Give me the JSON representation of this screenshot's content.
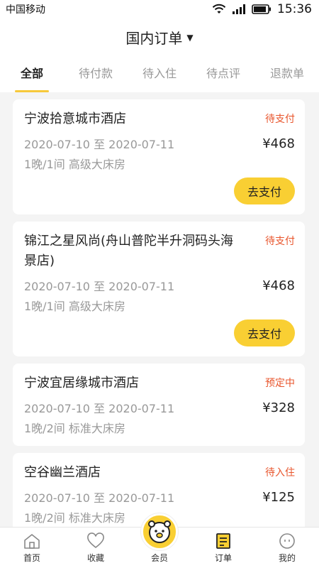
{
  "status_bar": {
    "carrier": "中国移动",
    "time": "15:36"
  },
  "header": {
    "title": "国内订单"
  },
  "tabs": [
    {
      "label": "全部",
      "active": true
    },
    {
      "label": "待付款"
    },
    {
      "label": "待入住"
    },
    {
      "label": "待点评"
    },
    {
      "label": "退款单"
    }
  ],
  "orders": [
    {
      "hotel": "宁波拾意城市酒店",
      "status": "待支付",
      "dates": "2020-07-10 至 2020-07-11",
      "price": "¥468",
      "room": "1晚/1间 高级大床房",
      "action": "去支付"
    },
    {
      "hotel": "锦江之星风尚(舟山普陀半升洞码头海景店)",
      "status": "待支付",
      "dates": "2020-07-10 至 2020-07-11",
      "price": "¥468",
      "room": "1晚/1间 高级大床房",
      "action": "去支付"
    },
    {
      "hotel": "宁波宜居缘城市酒店",
      "status": "预定中",
      "dates": "2020-07-10 至 2020-07-11",
      "price": "¥328",
      "room": "1晚/2间 标准大床房"
    },
    {
      "hotel": "空谷幽兰酒店",
      "status": "待入住",
      "dates": "2020-07-10 至 2020-07-11",
      "price": "¥125",
      "room": "1晚/2间 标准大床房"
    }
  ],
  "bottom_nav": [
    {
      "label": "首页",
      "icon": "home-icon"
    },
    {
      "label": "收藏",
      "icon": "heart-icon"
    },
    {
      "label": "会员",
      "icon": "mascot-icon"
    },
    {
      "label": "订单",
      "icon": "order-icon",
      "active": true
    },
    {
      "label": "我的",
      "icon": "profile-icon"
    }
  ],
  "colors": {
    "accent": "#f9cf33",
    "status": "#e8552c"
  }
}
